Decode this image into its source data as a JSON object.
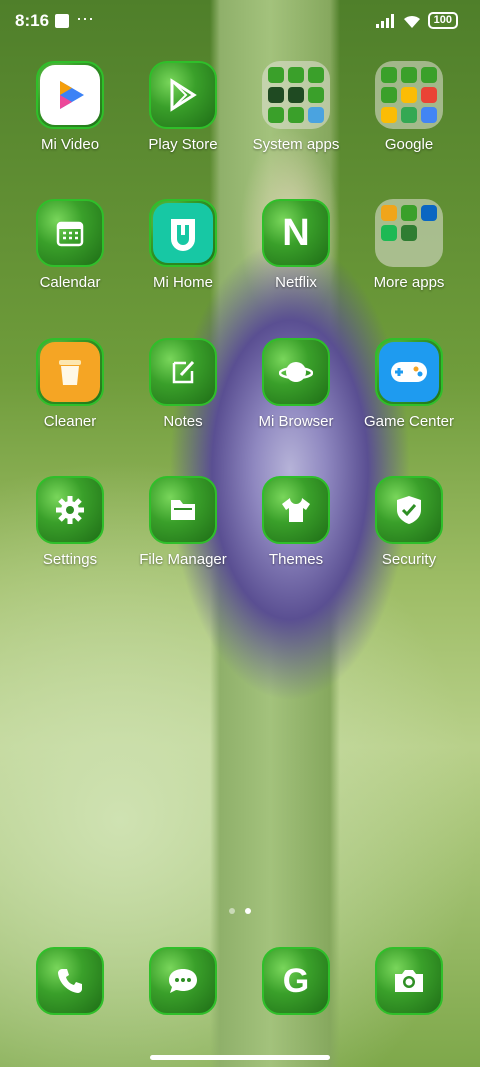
{
  "status": {
    "time": "8:16",
    "battery": "100"
  },
  "apps": [
    {
      "label": "Mi Video"
    },
    {
      "label": "Play Store"
    },
    {
      "label": "System apps"
    },
    {
      "label": "Google"
    },
    {
      "label": "Calendar"
    },
    {
      "label": "Mi Home"
    },
    {
      "label": "Netflix"
    },
    {
      "label": "More apps"
    },
    {
      "label": "Cleaner"
    },
    {
      "label": "Notes"
    },
    {
      "label": "Mi Browser"
    },
    {
      "label": "Game Center"
    },
    {
      "label": "Settings"
    },
    {
      "label": "File Manager"
    },
    {
      "label": "Themes"
    },
    {
      "label": "Security"
    }
  ],
  "dock": [
    {
      "icon": "phone-icon"
    },
    {
      "icon": "messages-icon"
    },
    {
      "icon": "google-icon"
    },
    {
      "icon": "camera-icon"
    }
  ],
  "colors": {
    "icon_green": "#2fbf2a",
    "netflix_letter": "N",
    "google_letter": "G"
  }
}
